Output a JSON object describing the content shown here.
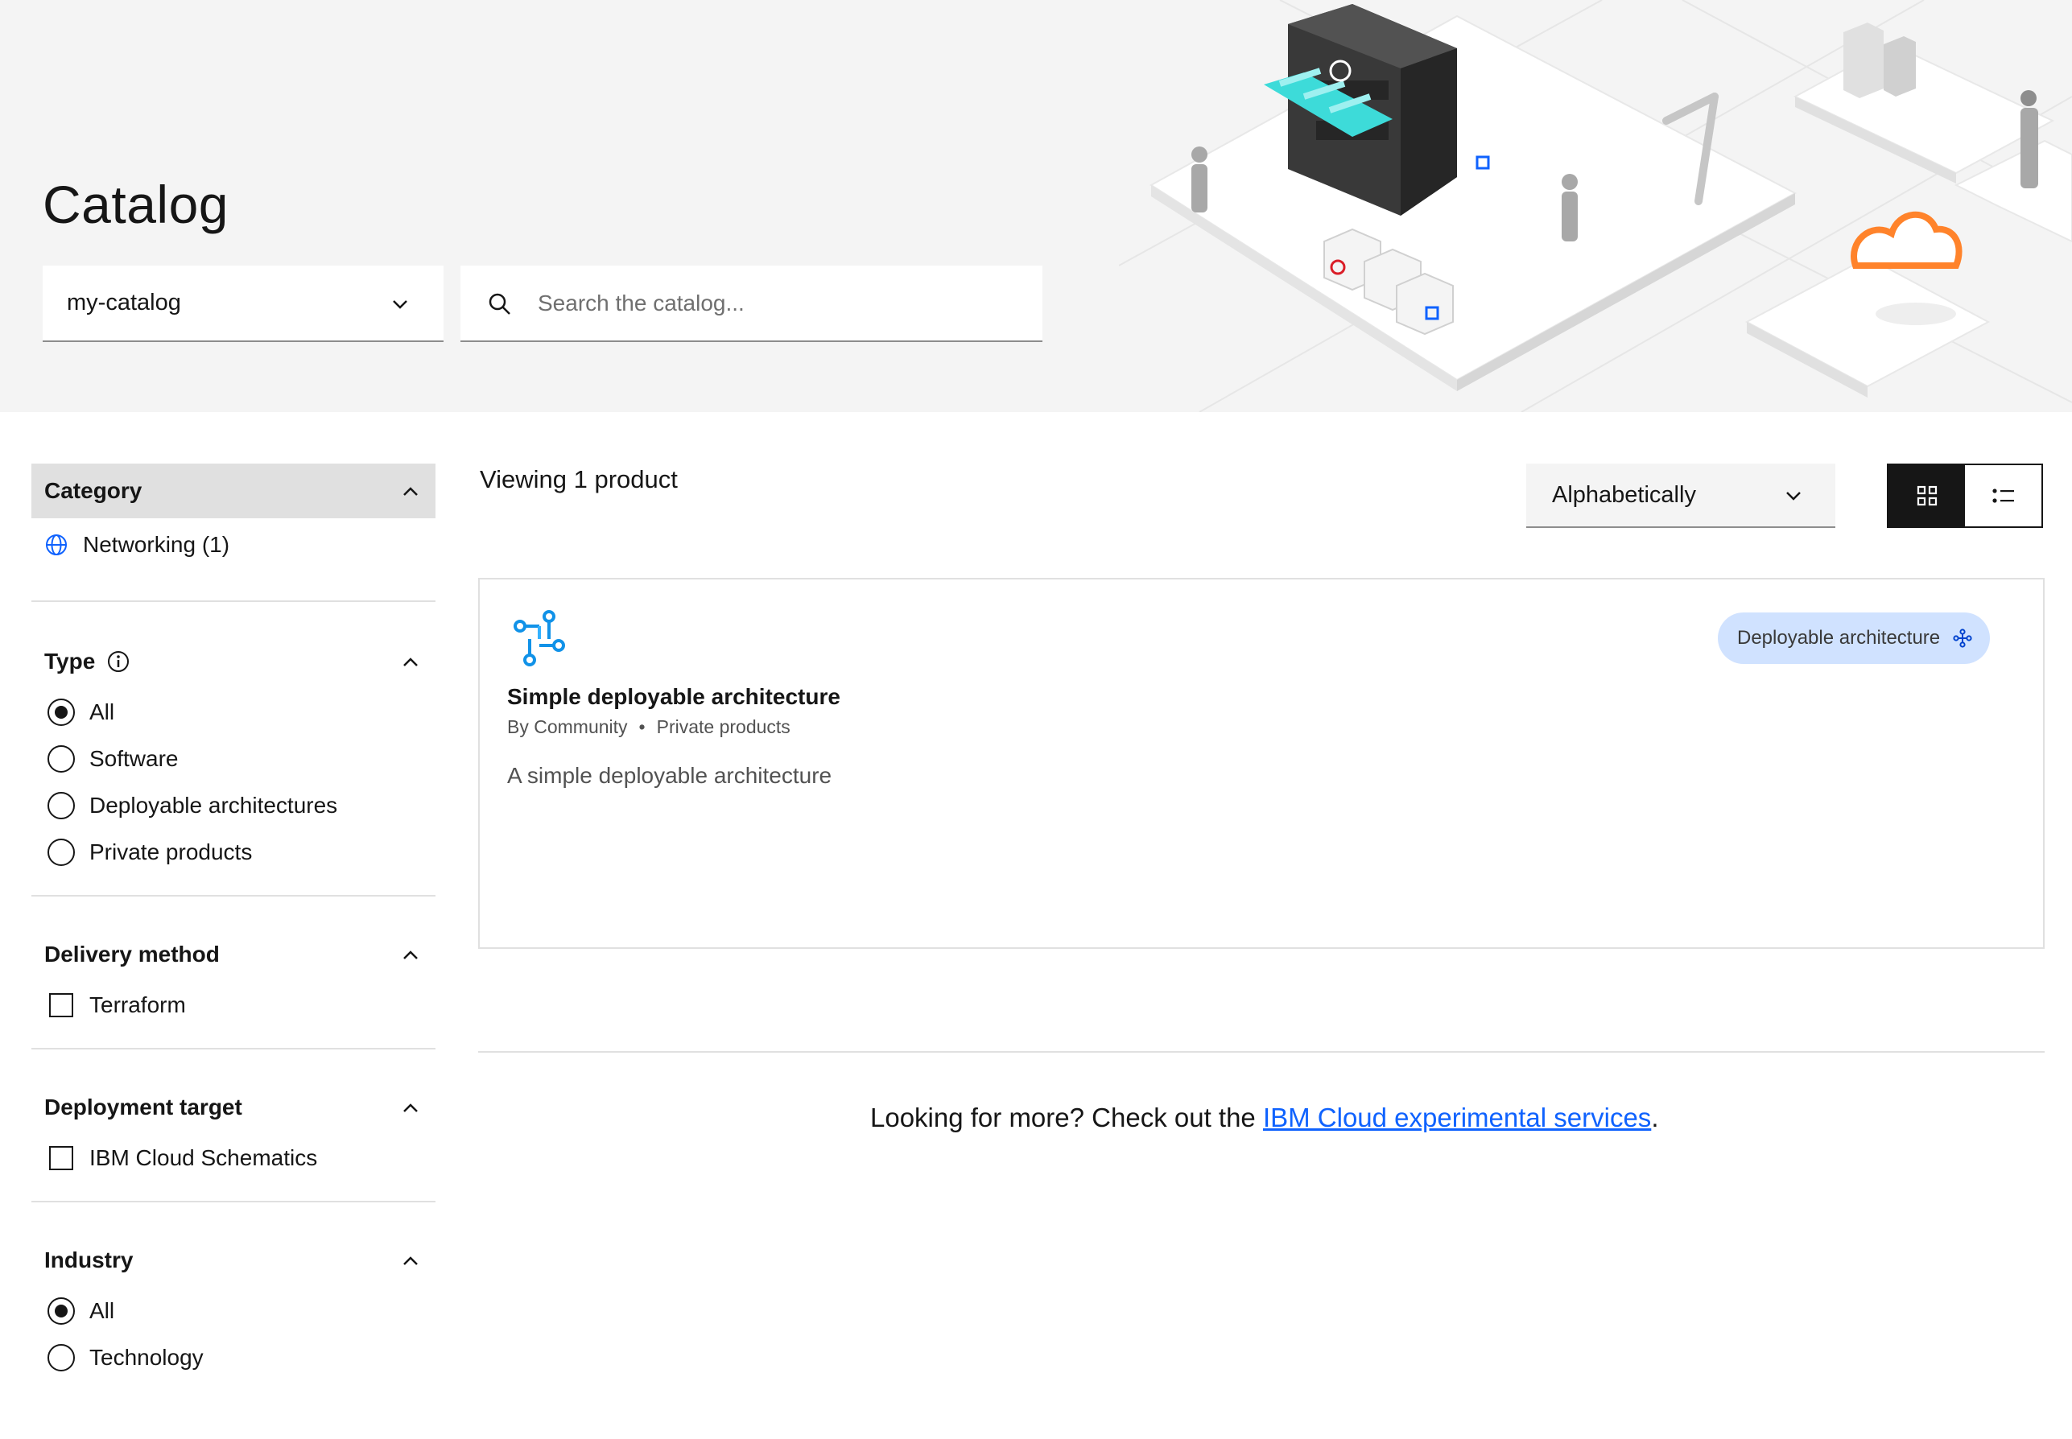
{
  "header": {
    "title": "Catalog",
    "catalog_select": {
      "value": "my-catalog"
    },
    "search": {
      "placeholder": "Search the catalog..."
    }
  },
  "sidebar": {
    "category": {
      "title": "Category",
      "items": [
        {
          "label": "Networking (1)",
          "icon": "globe-icon"
        }
      ]
    },
    "type": {
      "title": "Type",
      "options": [
        {
          "label": "All",
          "checked": true
        },
        {
          "label": "Software",
          "checked": false
        },
        {
          "label": "Deployable architectures",
          "checked": false
        },
        {
          "label": "Private products",
          "checked": false
        }
      ]
    },
    "delivery_method": {
      "title": "Delivery method",
      "options": [
        {
          "label": "Terraform",
          "checked": false
        }
      ]
    },
    "deployment_target": {
      "title": "Deployment target",
      "options": [
        {
          "label": "IBM Cloud Schematics",
          "checked": false
        }
      ]
    },
    "industry": {
      "title": "Industry",
      "options": [
        {
          "label": "All",
          "checked": true
        },
        {
          "label": "Technology",
          "checked": false
        }
      ]
    }
  },
  "main": {
    "viewing": "Viewing 1 product",
    "sort": {
      "value": "Alphabetically"
    },
    "view_mode": "grid",
    "products": [
      {
        "name": "Simple deployable architecture",
        "provider": "By Community",
        "visibility": "Private products",
        "description": "A simple deployable architecture",
        "tag": "Deployable architecture"
      }
    ],
    "more": {
      "prefix": "Looking for more? Check out the ",
      "link": "IBM Cloud experimental services",
      "suffix": "."
    }
  },
  "colors": {
    "banner_bg": "#f4f4f4",
    "link": "#0f62fe",
    "tag_bg": "#d0e2ff",
    "accent_teal": "#3ddbd9"
  }
}
